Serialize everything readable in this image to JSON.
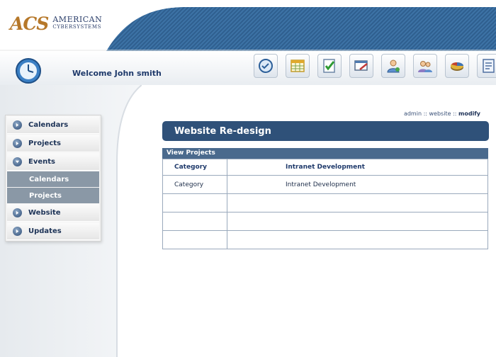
{
  "app": {
    "logo_mark": "ACS",
    "logo_line1": "AMERICAN",
    "logo_line2": "CYBERSYSTEMS"
  },
  "welcome": {
    "text": "Welcome John smith"
  },
  "toolbar": {
    "items": [
      {
        "icon": "clock-check-icon"
      },
      {
        "icon": "calendar-grid-icon"
      },
      {
        "icon": "checklist-icon"
      },
      {
        "icon": "edit-window-icon"
      },
      {
        "icon": "user-icon"
      },
      {
        "icon": "users-icon"
      },
      {
        "icon": "pie-chart-icon"
      },
      {
        "icon": "form-icon"
      }
    ]
  },
  "sidebar": {
    "items": [
      {
        "label": "Calendars"
      },
      {
        "label": "Projects"
      },
      {
        "label": "Events"
      },
      {
        "label": "Calendars"
      },
      {
        "label": "Projects"
      },
      {
        "label": "Website"
      },
      {
        "label": "Updates"
      }
    ]
  },
  "breadcrumb": {
    "p1": "admin",
    "sep": "::",
    "p2": "website",
    "p3": "modify"
  },
  "page": {
    "title": "Website Re-design"
  },
  "table": {
    "caption": "View Projects",
    "header": [
      "Category",
      "Intranet Development"
    ],
    "rows": [
      [
        "Category",
        "Intranet Development"
      ],
      [
        "",
        ""
      ],
      [
        "",
        ""
      ],
      [
        "",
        ""
      ]
    ]
  },
  "colors": {
    "primary": "#2f5179",
    "accent": "#b6782a",
    "submenu": "#8a98a6"
  }
}
